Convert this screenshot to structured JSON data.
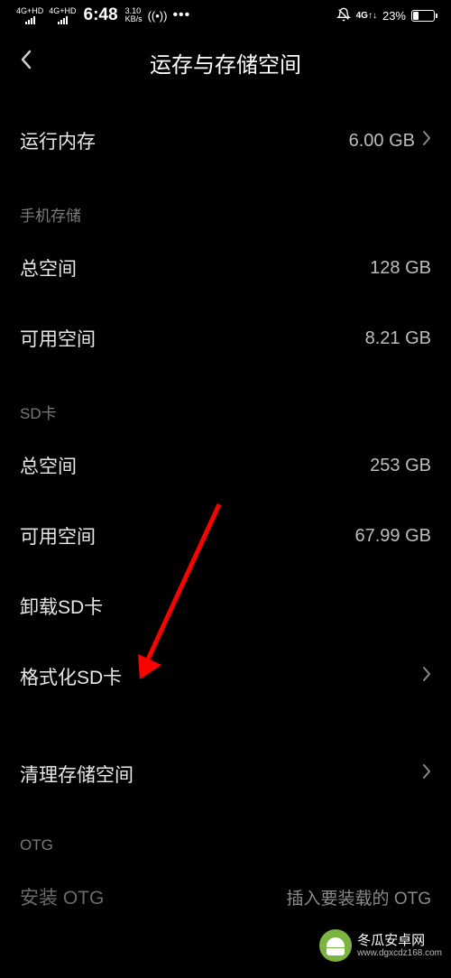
{
  "status": {
    "net_label1": "4G+HD",
    "net_label2": "4G+HD",
    "time": "6:48",
    "speed_value": "3.10",
    "speed_unit": "KB/s",
    "hotspot": "((•))",
    "more": "•••",
    "net_right": "4G↑↓",
    "battery_pct": "23%"
  },
  "header": {
    "title": "运存与存储空间"
  },
  "ram": {
    "label": "运行内存",
    "value": "6.00 GB"
  },
  "sections": {
    "phone_storage": "手机存储",
    "sd_card": "SD卡",
    "otg": "OTG"
  },
  "phone": {
    "total_label": "总空间",
    "total_value": "128 GB",
    "avail_label": "可用空间",
    "avail_value": "8.21 GB"
  },
  "sd": {
    "total_label": "总空间",
    "total_value": "253 GB",
    "avail_label": "可用空间",
    "avail_value": "67.99 GB",
    "unmount_label": "卸载SD卡",
    "format_label": "格式化SD卡"
  },
  "clean": {
    "label": "清理存储空间"
  },
  "otg": {
    "label": "安装 OTG",
    "hint": "插入要装载的 OTG"
  },
  "watermark": {
    "title": "冬瓜安卓网",
    "url": "www.dgxcdz168.com"
  }
}
